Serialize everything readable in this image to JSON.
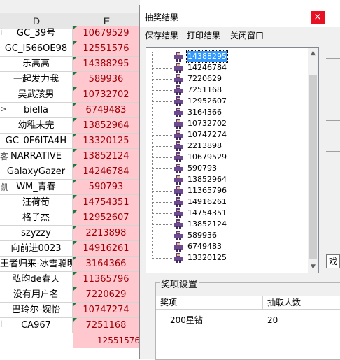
{
  "sheet": {
    "col_d": "D",
    "col_e": "E",
    "rows": [
      {
        "d": "GC_39号",
        "e": "10679529",
        "edge": "i"
      },
      {
        "d": "GC_I566OE98",
        "e": "12551576",
        "edge": ""
      },
      {
        "d": "乐高高",
        "e": "14388295",
        "edge": ""
      },
      {
        "d": "一起发力我",
        "e": "589936",
        "edge": ""
      },
      {
        "d": "吴武孩男",
        "e": "10732702",
        "edge": ""
      },
      {
        "d": "biella",
        "e": "6749483",
        "edge": ">"
      },
      {
        "d": "幼稚未完",
        "e": "13852964",
        "edge": ""
      },
      {
        "d": "GC_0F6ITA4H",
        "e": "13320125",
        "edge": ""
      },
      {
        "d": "NARRATIVE",
        "e": "13852124",
        "edge": "客"
      },
      {
        "d": "GalaxyGazer",
        "e": "14246784",
        "edge": ""
      },
      {
        "d": "WM_青春",
        "e": "590793",
        "edge": "凯"
      },
      {
        "d": "汪荷荀",
        "e": "14754351",
        "edge": ""
      },
      {
        "d": "格子杰",
        "e": "12952607",
        "edge": ""
      },
      {
        "d": "szyzzy",
        "e": "2213898",
        "edge": ""
      },
      {
        "d": "向前进0023",
        "e": "14916261",
        "edge": ""
      },
      {
        "d": "王者归来-冰雪聪明",
        "e": "3164366",
        "edge": ""
      },
      {
        "d": "弘昀de春天",
        "e": "11365796",
        "edge": ""
      },
      {
        "d": "没有用户名",
        "e": "7220629",
        "edge": ""
      },
      {
        "d": "巴玲尔-婉怡",
        "e": "10747274",
        "edge": ""
      },
      {
        "d": "CA967",
        "e": "7251168",
        "edge": "i"
      }
    ],
    "last_value": "12551576"
  },
  "dialog": {
    "title": "抽奖结果",
    "close_symbol": "×",
    "menu": [
      "保存结果",
      "打印结果",
      "关闭窗口"
    ],
    "results": [
      "14388295",
      "14246784",
      "7220629",
      "7251168",
      "12952607",
      "3164366",
      "10732702",
      "10747274",
      "2213898",
      "10679529",
      "590793",
      "13852964",
      "11365796",
      "14916261",
      "14754351",
      "13852124",
      "589936",
      "6749483",
      "13320125"
    ],
    "selected_index": 0,
    "scroll_up": "▲",
    "scroll_down": "▼",
    "side_char": "戏",
    "group_label": "奖项设置",
    "table_headers": [
      "奖项",
      "抽取人数"
    ],
    "prize_rows": [
      {
        "name": "200星钻",
        "count": "20"
      }
    ],
    "colors": {
      "close_red": "#e81123",
      "selection": "#3399ff",
      "cell_bad": "#ffc7ce",
      "cell_bad_text": "#9c0006"
    }
  }
}
